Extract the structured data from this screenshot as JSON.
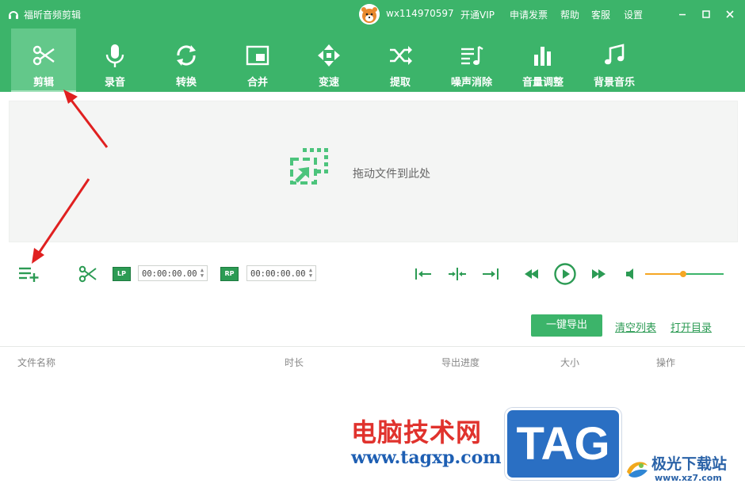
{
  "app": {
    "title": "福昕音频剪辑",
    "username": "wx114970597",
    "top_links": [
      "开通VIP",
      "申请发票",
      "帮助",
      "客服",
      "设置"
    ]
  },
  "window_controls": {
    "minimize_icon": "minimize-icon",
    "maximize_icon": "maximize-icon",
    "close_icon": "close-icon"
  },
  "toolbar": {
    "items": [
      {
        "label": "剪辑",
        "icon": "scissors-icon",
        "active": true
      },
      {
        "label": "录音",
        "icon": "microphone-icon",
        "active": false
      },
      {
        "label": "转换",
        "icon": "convert-icon",
        "active": false
      },
      {
        "label": "合并",
        "icon": "merge-icon",
        "active": false
      },
      {
        "label": "变速",
        "icon": "speed-icon",
        "active": false
      },
      {
        "label": "提取",
        "icon": "extract-icon",
        "active": false
      },
      {
        "label": "噪声消除",
        "icon": "denoise-icon",
        "active": false
      },
      {
        "label": "音量调整",
        "icon": "volume-adjust-icon",
        "active": false
      },
      {
        "label": "背景音乐",
        "icon": "music-note-icon",
        "active": false
      }
    ]
  },
  "dropzone": {
    "text": "拖动文件到此处"
  },
  "controls": {
    "lp_badge": "LP",
    "rp_badge": "RP",
    "lp_time": "00:00:00.00",
    "rp_time": "00:00:00.00",
    "volume_level": 0.48
  },
  "actions": {
    "export_label": "一键导出",
    "clear_label": "清空列表",
    "open_dir_label": "打开目录"
  },
  "table": {
    "columns": [
      "文件名称",
      "时长",
      "导出进度",
      "大小",
      "操作"
    ]
  },
  "watermarks": {
    "cn_text": "电脑技术网",
    "url": "www.tagxp.com",
    "tag": "TAG",
    "site_name": "极光下载站",
    "site_url": "www.xz7.com"
  },
  "colors": {
    "brand_green": "#3cb46a",
    "active_tab": "#63c88a",
    "accent_orange": "#f5a623",
    "annotation_red": "#e02020"
  }
}
